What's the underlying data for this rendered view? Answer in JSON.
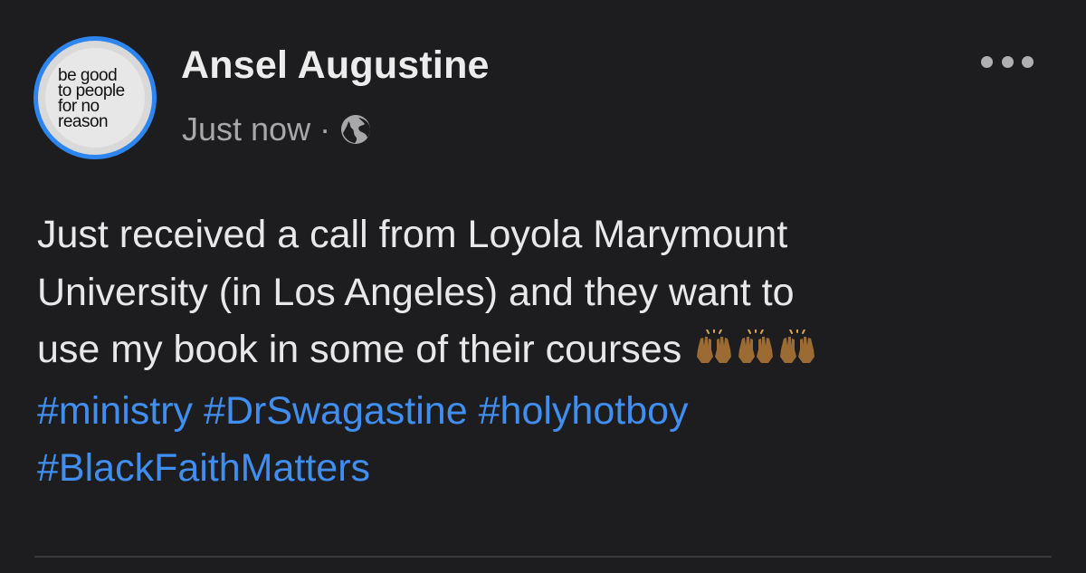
{
  "post": {
    "author_name": "Ansel Augustine",
    "timestamp": "Just now",
    "separator": "·",
    "privacy_icon": "globe-icon",
    "avatar_text": "be good\nto people\nfor no\nreason",
    "body_lines": [
      "Just received a call from Loyola Marymount",
      "University (in Los Angeles) and they want to",
      "use my book in some of their courses"
    ],
    "emoji": [
      "raising-hands-emoji",
      "raising-hands-emoji",
      "raising-hands-emoji"
    ],
    "hashtags_line1": [
      "#ministry",
      "#DrSwagastine",
      "#holyhotboy"
    ],
    "hashtags_line2": [
      "#BlackFaithMatters"
    ],
    "more_icon": "more-options-icon"
  },
  "colors": {
    "background": "#1d1d1f",
    "hashtag": "#3f8ef0",
    "avatar_ring": "#2d86f0",
    "meta_text": "#a8a8ab"
  }
}
